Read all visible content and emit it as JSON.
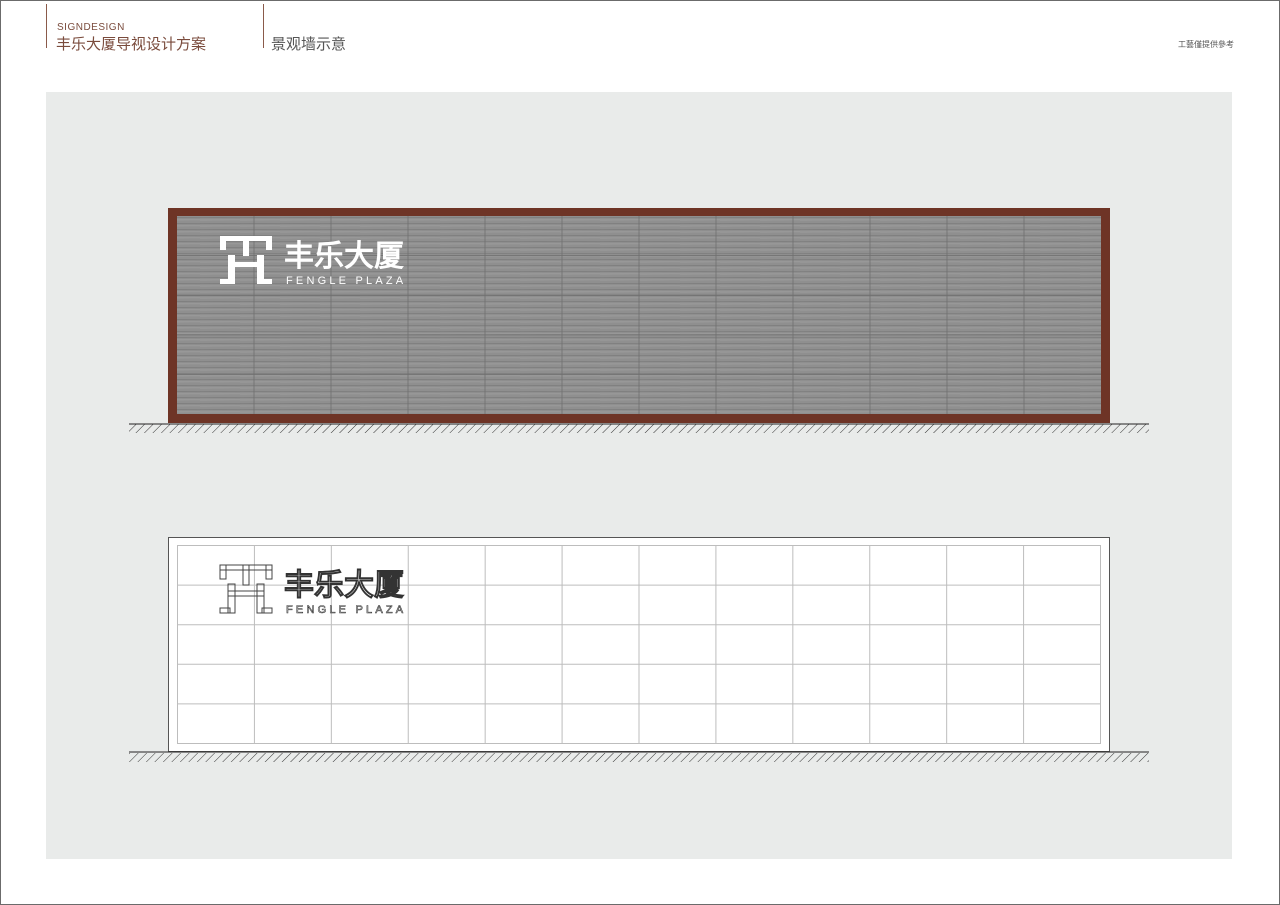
{
  "header": {
    "brand_small": "SIGNDESIGN",
    "brand_title": "丰乐大厦导视设计方案",
    "section_title": "景观墙示意",
    "note": "工藝僅提供參考"
  },
  "logo": {
    "name_cn": "丰乐大厦",
    "name_en": "FENGLE PLAZA"
  },
  "colors": {
    "frame_brown": "#6e3426",
    "stone_gray": "#8e8e8e",
    "panel_bg": "#e9ebea",
    "header_accent": "#7a4b3c"
  },
  "grid": {
    "columns": 12,
    "rows": 5
  }
}
